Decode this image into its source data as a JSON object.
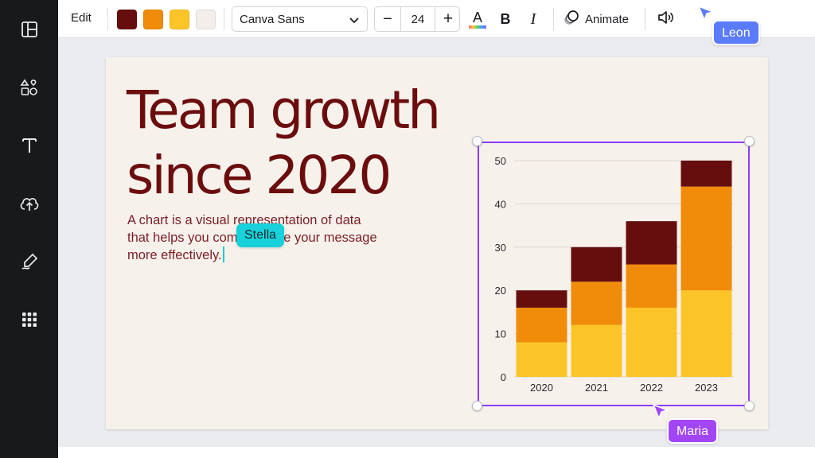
{
  "sidebar": {
    "items": [
      {
        "icon": "layout-icon"
      },
      {
        "icon": "elements-icon"
      },
      {
        "icon": "text-icon"
      },
      {
        "icon": "upload-icon"
      },
      {
        "icon": "draw-icon"
      },
      {
        "icon": "apps-grid-icon"
      }
    ]
  },
  "toolbar": {
    "edit_label": "Edit",
    "swatches": [
      "#660e0e",
      "#f08c0a",
      "#fcc527",
      "#f3eee9"
    ],
    "font_name": "Canva Sans",
    "font_size": "24",
    "minus_symbol": "−",
    "plus_symbol": "+",
    "text_color_glyph": "A",
    "bold_glyph": "B",
    "italic_glyph": "I",
    "animate_label": "Animate"
  },
  "page": {
    "headline_line1": "Team growth",
    "headline_line2": "since 2020",
    "body_line1": "A chart is a visual representation of data",
    "body_line2": "that helps you communicate your message",
    "body_line3": "more effectively."
  },
  "collaborators": {
    "leon": {
      "name": "Leon",
      "color": "#5b7cfa"
    },
    "stella": {
      "name": "Stella",
      "color": "#18d1da"
    },
    "maria": {
      "name": "Maria",
      "color": "#a246f5"
    }
  },
  "colors": {
    "brand_purple": "#8b3dff",
    "headline": "#6b0d0d",
    "body_text": "#7a1f26"
  },
  "chart_data": {
    "type": "bar",
    "stacked": true,
    "categories": [
      "2020",
      "2021",
      "2022",
      "2023"
    ],
    "series": [
      {
        "values": [
          8,
          12,
          16,
          20
        ],
        "color": "#fcc527"
      },
      {
        "values": [
          8,
          10,
          10,
          24
        ],
        "color": "#f08c0a"
      },
      {
        "values": [
          4,
          8,
          10,
          6
        ],
        "color": "#660e0e"
      }
    ],
    "ylim": [
      0,
      50
    ],
    "yticks": [
      0,
      10,
      20,
      30,
      40,
      50
    ],
    "grid": true,
    "legend": "none"
  }
}
